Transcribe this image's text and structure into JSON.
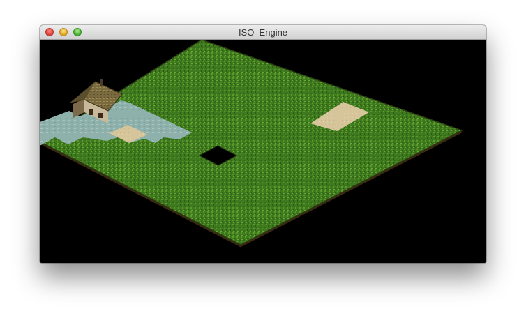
{
  "window": {
    "title": "ISO–Engine"
  },
  "scene": {
    "type": "isometric tile map",
    "tiles": {
      "grass_color": "#3f7a1e",
      "water_color": "#8fb2ad",
      "sand_color": "#d5c49a",
      "void_color": "#000000"
    },
    "objects": [
      "farmhouse",
      "sand-patch",
      "sand-patch",
      "water-area",
      "hole"
    ]
  },
  "icons": {
    "close": "close-button",
    "minimize": "minimize-button",
    "zoom": "zoom-button"
  }
}
